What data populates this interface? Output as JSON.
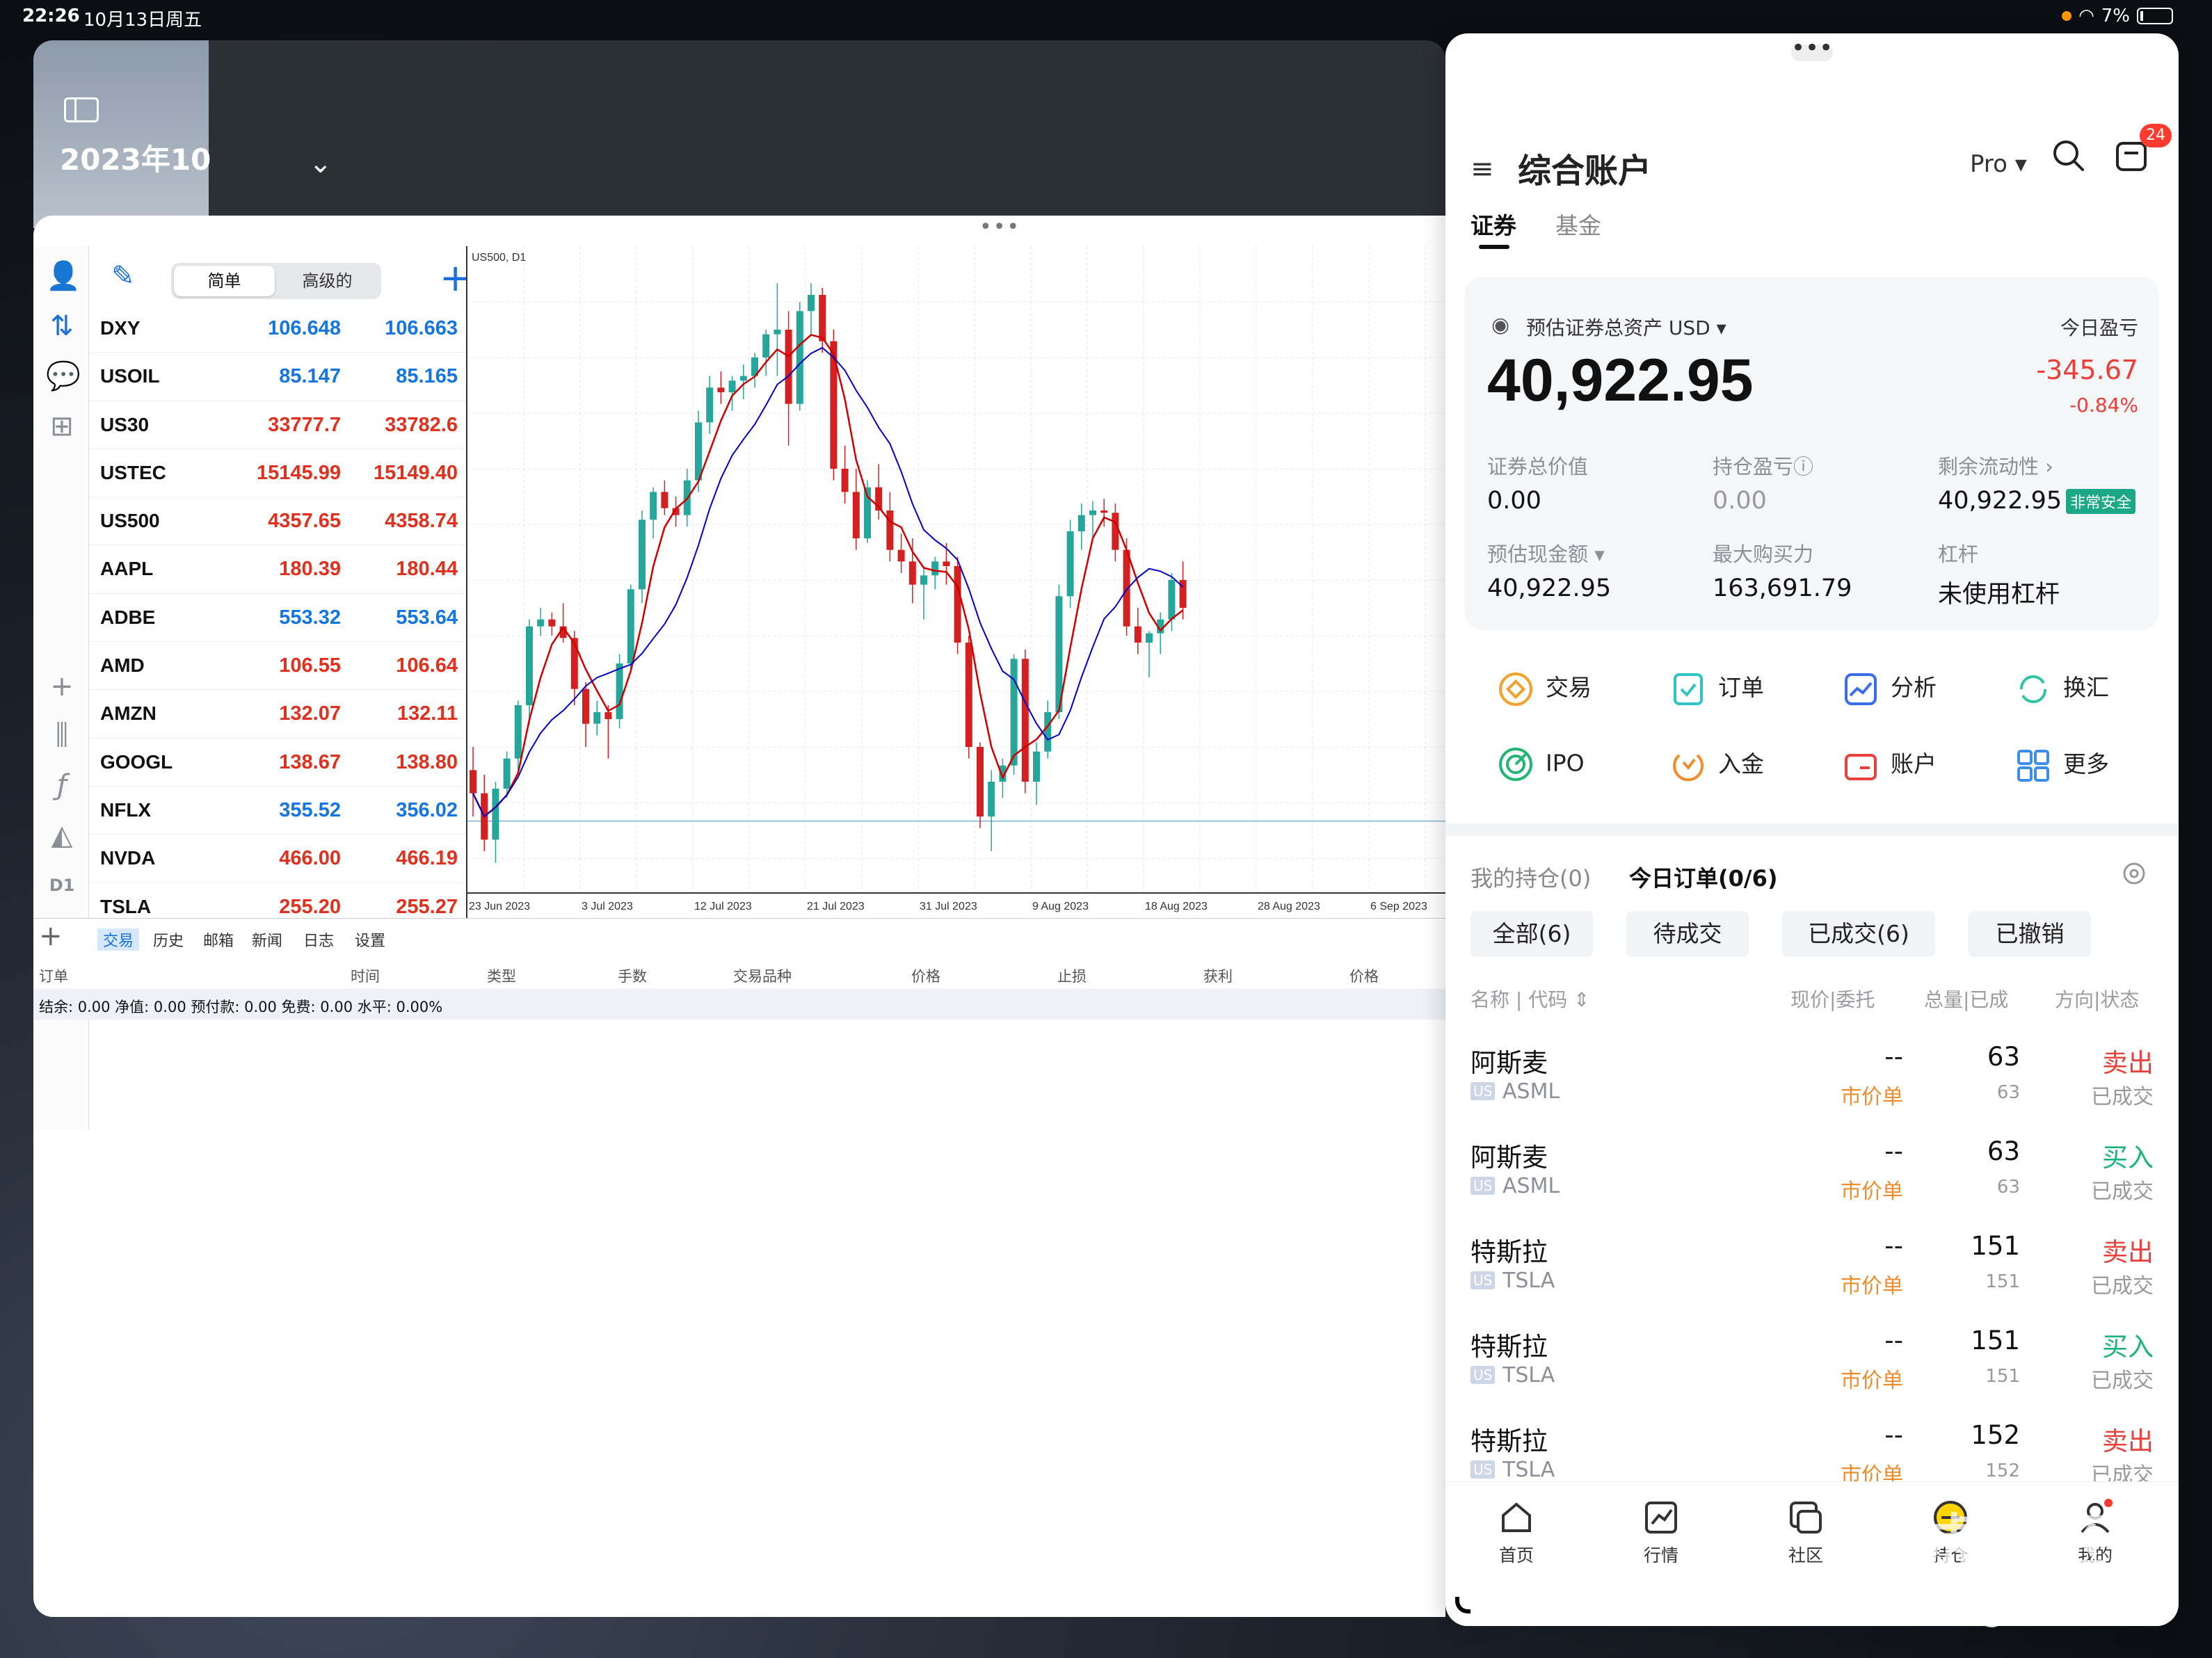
{
  "status_bar": {
    "time": "22:26",
    "date": "10月13日周五",
    "battery": "7%"
  },
  "background_app": {
    "title": "2023年10"
  },
  "mt5": {
    "seg_simple": "简单",
    "seg_advanced": "高级的",
    "quotes": [
      {
        "symbol": "DXY",
        "bid": "106.648",
        "ask": "106.663",
        "color": "blue"
      },
      {
        "symbol": "USOIL",
        "bid": "85.147",
        "ask": "85.165",
        "color": "blue"
      },
      {
        "symbol": "US30",
        "bid": "33777.7",
        "ask": "33782.6",
        "color": "red"
      },
      {
        "symbol": "USTEC",
        "bid": "15145.99",
        "ask": "15149.40",
        "color": "red"
      },
      {
        "symbol": "US500",
        "bid": "4357.65",
        "ask": "4358.74",
        "color": "red"
      },
      {
        "symbol": "AAPL",
        "bid": "180.39",
        "ask": "180.44",
        "color": "red"
      },
      {
        "symbol": "ADBE",
        "bid": "553.32",
        "ask": "553.64",
        "color": "blue"
      },
      {
        "symbol": "AMD",
        "bid": "106.55",
        "ask": "106.64",
        "color": "red"
      },
      {
        "symbol": "AMZN",
        "bid": "132.07",
        "ask": "132.11",
        "color": "red"
      },
      {
        "symbol": "GOOGL",
        "bid": "138.67",
        "ask": "138.80",
        "color": "red"
      },
      {
        "symbol": "NFLX",
        "bid": "355.52",
        "ask": "356.02",
        "color": "blue"
      },
      {
        "symbol": "NVDA",
        "bid": "466.00",
        "ask": "466.19",
        "color": "red"
      },
      {
        "symbol": "TSLA",
        "bid": "255.20",
        "ask": "255.27",
        "color": "red"
      }
    ],
    "toolbar_labels": {
      "timeframe": "D1"
    },
    "chart_label": "US500, D1",
    "x_ticks": [
      "23 Jun 2023",
      "3 Jul 2023",
      "12 Jul 2023",
      "21 Jul 2023",
      "31 Jul 2023",
      "9 Aug 2023",
      "18 Aug 2023",
      "28 Aug 2023",
      "6 Sep 2023"
    ],
    "tabs": [
      "交易",
      "历史",
      "邮箱",
      "新闻",
      "日志",
      "设置"
    ],
    "columns": [
      "订单",
      "时间",
      "类型",
      "手数",
      "交易品种",
      "价格",
      "止损",
      "获利",
      "价格"
    ],
    "balance": "结余:  0.00 净值:  0.00 预付款:  0.00 免费:  0.00 水平:  0.00%"
  },
  "chart_data": {
    "type": "candlestick",
    "title": "US500, D1",
    "x_ticks": [
      "23 Jun 2023",
      "3 Jul 2023",
      "12 Jul 2023",
      "21 Jul 2023",
      "31 Jul 2023",
      "9 Aug 2023",
      "18 Aug 2023",
      "28 Aug 2023",
      "6 Sep 2023"
    ],
    "candles": [
      [
        4390,
        4400,
        4370,
        4380
      ],
      [
        4380,
        4388,
        4355,
        4360
      ],
      [
        4360,
        4385,
        4350,
        4382
      ],
      [
        4382,
        4398,
        4378,
        4395
      ],
      [
        4395,
        4420,
        4390,
        4418
      ],
      [
        4418,
        4455,
        4410,
        4452
      ],
      [
        4452,
        4460,
        4448,
        4455
      ],
      [
        4455,
        4458,
        4448,
        4452
      ],
      [
        4452,
        4462,
        4445,
        4447
      ],
      [
        4447,
        4450,
        4418,
        4425
      ],
      [
        4425,
        4428,
        4400,
        4410
      ],
      [
        4410,
        4420,
        4405,
        4415
      ],
      [
        4415,
        4418,
        4395,
        4412
      ],
      [
        4412,
        4440,
        4408,
        4436
      ],
      [
        4436,
        4470,
        4432,
        4468
      ],
      [
        4468,
        4502,
        4462,
        4498
      ],
      [
        4498,
        4512,
        4490,
        4510
      ],
      [
        4510,
        4515,
        4500,
        4503
      ],
      [
        4503,
        4508,
        4495,
        4500
      ],
      [
        4500,
        4520,
        4495,
        4515
      ],
      [
        4515,
        4545,
        4510,
        4540
      ],
      [
        4540,
        4560,
        4535,
        4555
      ],
      [
        4555,
        4562,
        4548,
        4553
      ],
      [
        4553,
        4560,
        4545,
        4558
      ],
      [
        4558,
        4565,
        4550,
        4560
      ],
      [
        4560,
        4570,
        4555,
        4568
      ],
      [
        4568,
        4580,
        4560,
        4578
      ],
      [
        4578,
        4600,
        4560,
        4580
      ],
      [
        4580,
        4588,
        4530,
        4548
      ],
      [
        4548,
        4592,
        4545,
        4588
      ],
      [
        4588,
        4600,
        4578,
        4595
      ],
      [
        4595,
        4598,
        4570,
        4575
      ],
      [
        4575,
        4580,
        4515,
        4520
      ],
      [
        4520,
        4530,
        4505,
        4510
      ],
      [
        4510,
        4520,
        4485,
        4490
      ],
      [
        4490,
        4515,
        4488,
        4512
      ],
      [
        4512,
        4522,
        4498,
        4502
      ],
      [
        4502,
        4510,
        4480,
        4485
      ],
      [
        4485,
        4492,
        4475,
        4480
      ],
      [
        4480,
        4490,
        4462,
        4470
      ],
      [
        4470,
        4478,
        4455,
        4474
      ],
      [
        4474,
        4482,
        4468,
        4480
      ],
      [
        4480,
        4488,
        4470,
        4478
      ],
      [
        4478,
        4482,
        4440,
        4445
      ],
      [
        4445,
        4448,
        4395,
        4400
      ],
      [
        4400,
        4402,
        4365,
        4370
      ],
      [
        4370,
        4390,
        4355,
        4385
      ],
      [
        4385,
        4395,
        4378,
        4392
      ],
      [
        4392,
        4440,
        4388,
        4438
      ],
      [
        4438,
        4442,
        4380,
        4385
      ],
      [
        4385,
        4402,
        4375,
        4398
      ],
      [
        4398,
        4420,
        4395,
        4415
      ],
      [
        4415,
        4470,
        4412,
        4465
      ],
      [
        4465,
        4498,
        4460,
        4493
      ],
      [
        4493,
        4505,
        4485,
        4500
      ],
      [
        4500,
        4506,
        4490,
        4502
      ],
      [
        4502,
        4507,
        4495,
        4501
      ],
      [
        4501,
        4505,
        4480,
        4485
      ],
      [
        4485,
        4490,
        4448,
        4452
      ],
      [
        4452,
        4460,
        4440,
        4445
      ],
      [
        4445,
        4450,
        4430,
        4449
      ],
      [
        4449,
        4458,
        4440,
        4455
      ],
      [
        4455,
        4475,
        4450,
        4472
      ],
      [
        4472,
        4480,
        4455,
        4460
      ]
    ],
    "ma_fast_color": "#d00000",
    "ma_slow_color": "#0000cc",
    "up_color": "#26a69a",
    "down_color": "#d32020"
  },
  "tiger": {
    "title": "综合账户",
    "pro": "Pro ▾",
    "badge": "24",
    "tab_securities": "证券",
    "tab_funds": "基金",
    "asset_label": "预估证券总资产  USD ▾",
    "today_pnl_label": "今日盈亏",
    "total_assets": "40,922.95",
    "today_pnl": "-345.67",
    "today_pnl_pct": "-0.84%",
    "metrics": [
      {
        "label": "证券总价值",
        "value": "0.00"
      },
      {
        "label": "持仓盈亏ⓘ",
        "value": "0.00"
      },
      {
        "label": "剩余流动性  ›",
        "value": "40,922.95",
        "badge": "非常安全"
      },
      {
        "label": "预估现金额 ▾",
        "value": "40,922.95"
      },
      {
        "label": "最大购买力",
        "value": "163,691.79"
      },
      {
        "label": "杠杆",
        "value": "未使用杠杆"
      }
    ],
    "actions": [
      "交易",
      "订单",
      "分析",
      "换汇",
      "IPO",
      "入金",
      "账户",
      "更多"
    ],
    "positions_tab": "我的持仓(0)",
    "orders_tab": "今日订单(0/6)",
    "filters": [
      "全部(6)",
      "待成交",
      "已成交(6)",
      "已撤销"
    ],
    "table_head": [
      "名称 | 代码 ⇕",
      "现价|委托",
      "总量|已成",
      "方向|状态"
    ],
    "orders": [
      {
        "name": "阿斯麦",
        "market": "US",
        "code": "ASML",
        "price": "--",
        "type": "市价单",
        "qty": "63",
        "filled": "63",
        "side": "卖出",
        "status": "已成交",
        "dir": "sell"
      },
      {
        "name": "阿斯麦",
        "market": "US",
        "code": "ASML",
        "price": "--",
        "type": "市价单",
        "qty": "63",
        "filled": "63",
        "side": "买入",
        "status": "已成交",
        "dir": "buy"
      },
      {
        "name": "特斯拉",
        "market": "US",
        "code": "TSLA",
        "price": "--",
        "type": "市价单",
        "qty": "151",
        "filled": "151",
        "side": "卖出",
        "status": "已成交",
        "dir": "sell"
      },
      {
        "name": "特斯拉",
        "market": "US",
        "code": "TSLA",
        "price": "--",
        "type": "市价单",
        "qty": "151",
        "filled": "151",
        "side": "买入",
        "status": "已成交",
        "dir": "buy"
      },
      {
        "name": "特斯拉",
        "market": "US",
        "code": "TSLA",
        "price": "--",
        "type": "市价单",
        "qty": "152",
        "filled": "152",
        "side": "卖出",
        "status": "已成交",
        "dir": "sell"
      }
    ],
    "nav": [
      "首页",
      "行情",
      "社区",
      "持仓",
      "我的"
    ]
  },
  "watermark": {
    "main": "老虎社区",
    "handle": "@醒覺戰場"
  }
}
